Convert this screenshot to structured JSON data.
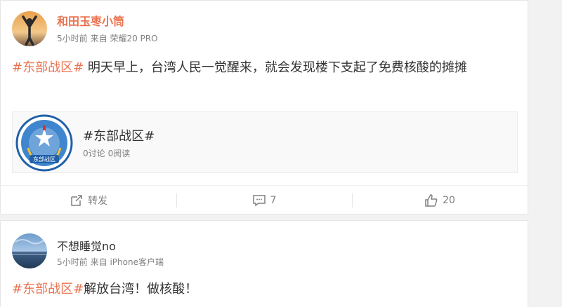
{
  "posts": [
    {
      "username": "和田玉枣小筒",
      "time": "5小时前",
      "source": "来自 荣耀20 PRO",
      "content_hashtag": "#东部战区#",
      "content_text": " 明天早上，台湾人民一觉醒来，就会发现楼下支起了免费核酸的摊摊",
      "topic": {
        "title": "#东部战区#",
        "discussions": "0讨论",
        "reads": "0阅读",
        "logo_text": "东部战区"
      },
      "actions": {
        "repost_label": "转发",
        "comments_count": "7",
        "likes_count": "20"
      }
    },
    {
      "username": "不想睡觉no",
      "time": "5小时前",
      "source": "来自 iPhone客户端",
      "content_hashtag": "#东部战区#",
      "content_text": "解放台湾！做核酸！"
    }
  ],
  "colors": {
    "accent": "#eb7350",
    "text": "#333333",
    "meta": "#808080"
  },
  "icons": [
    "repost-icon",
    "comment-icon",
    "like-icon"
  ]
}
